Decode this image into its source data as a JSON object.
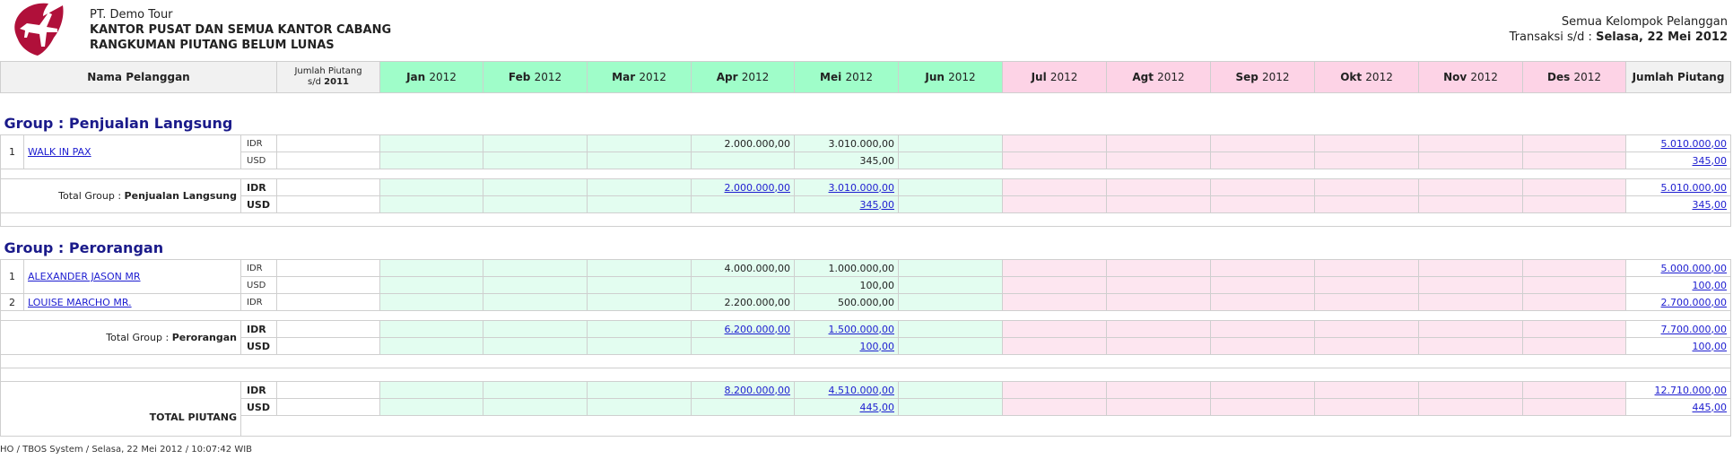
{
  "company": {
    "name": "PT. Demo Tour",
    "line2": "KANTOR PUSAT DAN SEMUA KANTOR CABANG",
    "line3": "RANGKUMAN PIUTANG BELUM LUNAS"
  },
  "filter": {
    "group": "Semua Kelompok Pelanggan",
    "trans_label": "Transaksi s/d :",
    "trans_date": "Selasa, 22 Mei 2012"
  },
  "columns": {
    "customer": "Nama Pelanggan",
    "prior_line1": "Jumlah Piutang",
    "prior_line2a": "s/d",
    "prior_line2b": "2011",
    "months": [
      {
        "m": "Jan",
        "y": "2012"
      },
      {
        "m": "Feb",
        "y": "2012"
      },
      {
        "m": "Mar",
        "y": "2012"
      },
      {
        "m": "Apr",
        "y": "2012"
      },
      {
        "m": "Mei",
        "y": "2012"
      },
      {
        "m": "Jun",
        "y": "2012"
      },
      {
        "m": "Jul",
        "y": "2012"
      },
      {
        "m": "Agt",
        "y": "2012"
      },
      {
        "m": "Sep",
        "y": "2012"
      },
      {
        "m": "Okt",
        "y": "2012"
      },
      {
        "m": "Nov",
        "y": "2012"
      },
      {
        "m": "Des",
        "y": "2012"
      }
    ],
    "total": "Jumlah Piutang"
  },
  "groups": [
    {
      "title": "Group : Penjualan Langsung",
      "customers": [
        {
          "no": "1",
          "name": "WALK IN PAX",
          "rows": [
            {
              "cur": "IDR",
              "apr": "2.000.000,00",
              "mei": "3.010.000,00",
              "total": "5.010.000,00"
            },
            {
              "cur": "USD",
              "apr": "",
              "mei": "345,00",
              "total": "345,00"
            }
          ]
        }
      ],
      "total_label": "Total Group :",
      "total_name": "Penjualan Langsung",
      "totals": [
        {
          "cur": "IDR",
          "apr": "2.000.000,00",
          "mei": "3.010.000,00",
          "total": "5.010.000,00"
        },
        {
          "cur": "USD",
          "apr": "",
          "mei": "345,00",
          "total": "345,00"
        }
      ]
    },
    {
      "title": "Group : Perorangan",
      "customers": [
        {
          "no": "1",
          "name": "ALEXANDER JASON MR",
          "rows": [
            {
              "cur": "IDR",
              "apr": "4.000.000,00",
              "mei": "1.000.000,00",
              "total": "5.000.000,00"
            },
            {
              "cur": "USD",
              "apr": "",
              "mei": "100,00",
              "total": "100,00"
            }
          ]
        },
        {
          "no": "2",
          "name": "LOUISE MARCHO MR.",
          "rows": [
            {
              "cur": "IDR",
              "apr": "2.200.000,00",
              "mei": "500.000,00",
              "total": "2.700.000,00"
            }
          ]
        }
      ],
      "total_label": "Total Group :",
      "total_name": "Perorangan",
      "totals": [
        {
          "cur": "IDR",
          "apr": "6.200.000,00",
          "mei": "1.500.000,00",
          "total": "7.700.000,00"
        },
        {
          "cur": "USD",
          "apr": "",
          "mei": "100,00",
          "total": "100,00"
        }
      ]
    }
  ],
  "grand": {
    "label": "TOTAL PIUTANG",
    "rows": [
      {
        "cur": "IDR",
        "apr": "8.200.000,00",
        "mei": "4.510.000,00",
        "total": "12.710.000,00"
      },
      {
        "cur": "USD",
        "apr": "",
        "mei": "445,00",
        "total": "445,00"
      }
    ]
  },
  "footer": "HO / TBOS System / Selasa, 22 Mei 2012 / 10:07:42 WIB"
}
